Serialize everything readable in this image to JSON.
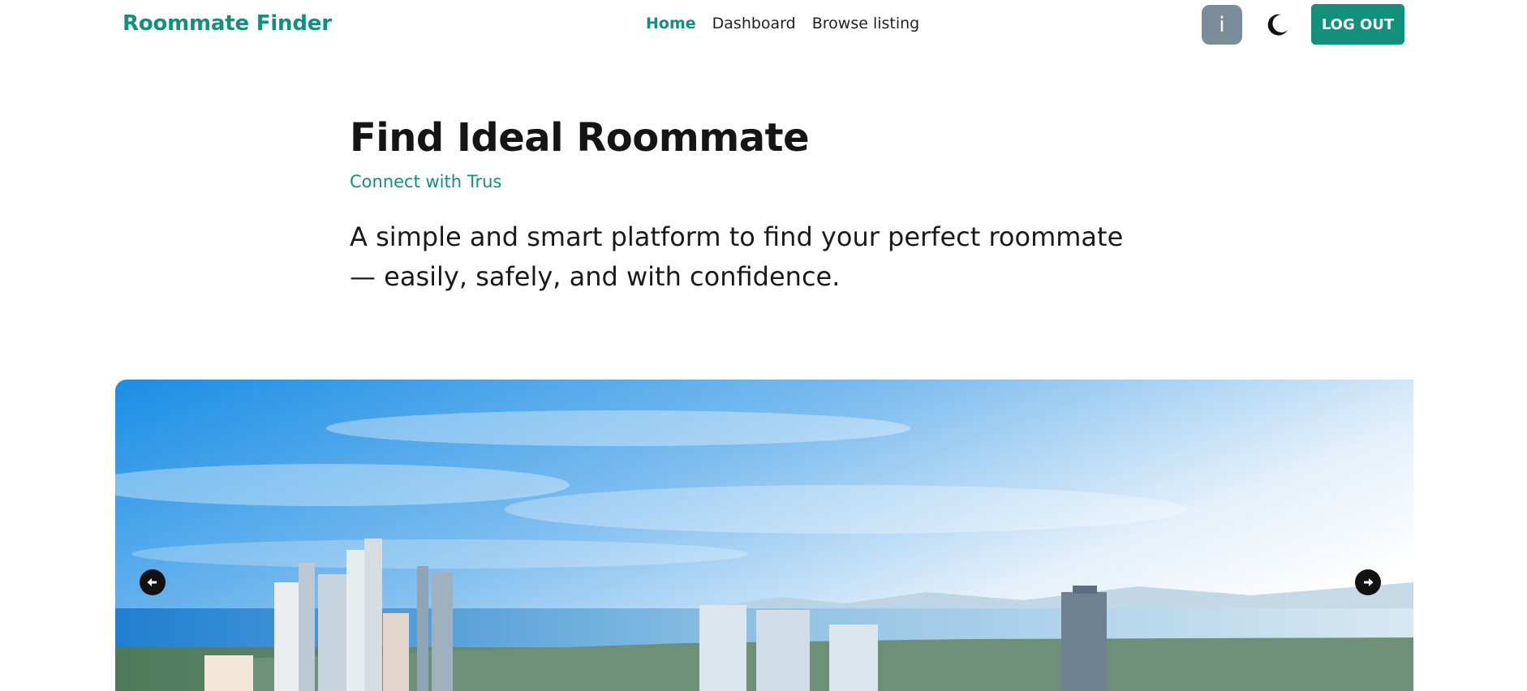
{
  "header": {
    "brand": "Roommate Finder",
    "nav": [
      {
        "label": "Home",
        "active": true
      },
      {
        "label": "Dashboard",
        "active": false
      },
      {
        "label": "Browse listing",
        "active": false
      }
    ],
    "avatar_initial": "i",
    "theme_toggle_icon": "moon-icon",
    "logout_label": "LOG OUT"
  },
  "hero": {
    "title": "Find Ideal Roommate",
    "tagline": "Connect with Trus",
    "description": "A simple and smart platform to find your perfect roommate — easily, safely, and with confidence."
  },
  "carousel": {
    "image": "city-skyline-coast",
    "prev_icon": "arrow-left-icon",
    "next_icon": "arrow-right-icon"
  },
  "colors": {
    "accent": "#12907c",
    "avatar_bg": "#7b8d99",
    "text": "#1a1a1a"
  }
}
